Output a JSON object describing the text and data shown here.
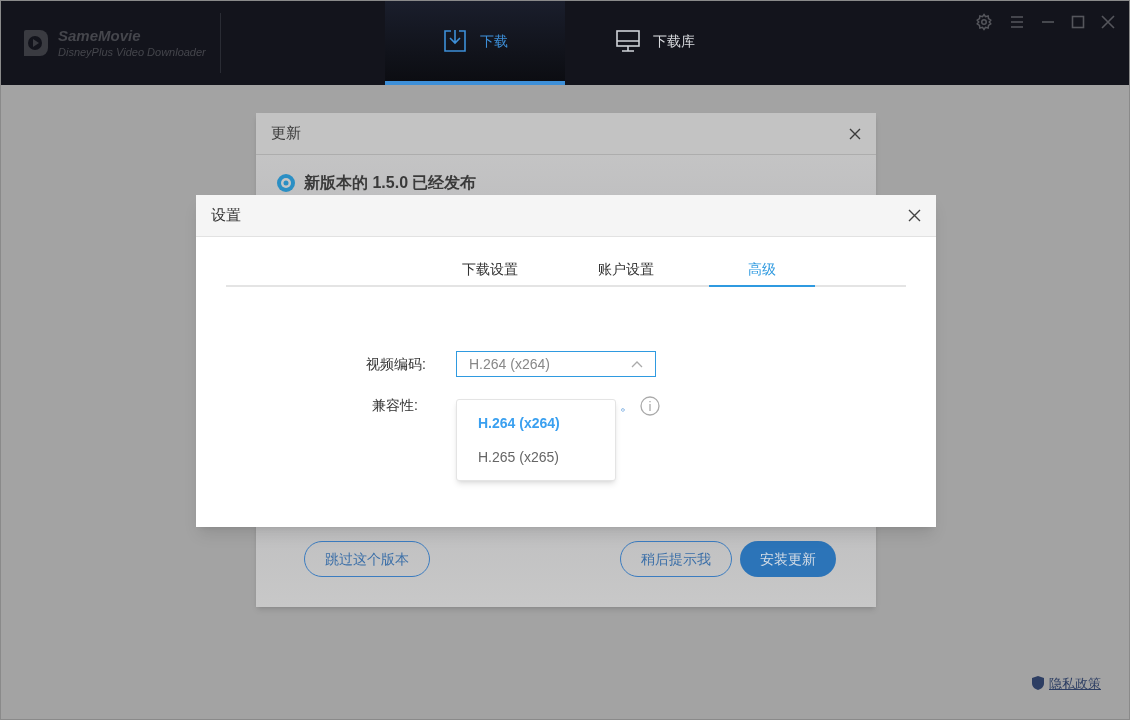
{
  "app": {
    "brand": "SameMovie",
    "subtitle": "DisneyPlus Video Downloader"
  },
  "nav_tabs": [
    {
      "label": "下载",
      "kind": "download",
      "selected": true
    },
    {
      "label": "下载库",
      "kind": "monitor",
      "selected": false
    }
  ],
  "update_dialog": {
    "title": "更新",
    "heading": "新版本的 1.5.0 已经发布",
    "buttons": [
      {
        "label": "跳过这个版本",
        "kind": "outline"
      },
      {
        "label": "稍后提示我",
        "kind": "outline"
      },
      {
        "label": "安装更新",
        "kind": "primary"
      }
    ]
  },
  "settings_dialog": {
    "title": "设置",
    "tabs": [
      {
        "label": "下载设置",
        "selected": false
      },
      {
        "label": "账户设置",
        "selected": false
      },
      {
        "label": "高级",
        "selected": true
      }
    ],
    "codec_label": "视频编码:",
    "codec_value": "H.264 (x264)",
    "dropdown_expanded": true,
    "options": [
      {
        "label": "H.264 (x264)",
        "selected": true
      },
      {
        "label": "H.265 (x265)",
        "selected": false
      }
    ],
    "compat_label": "兼容性:",
    "compat_text": "。"
  },
  "privacy_link": "隐私政策"
}
